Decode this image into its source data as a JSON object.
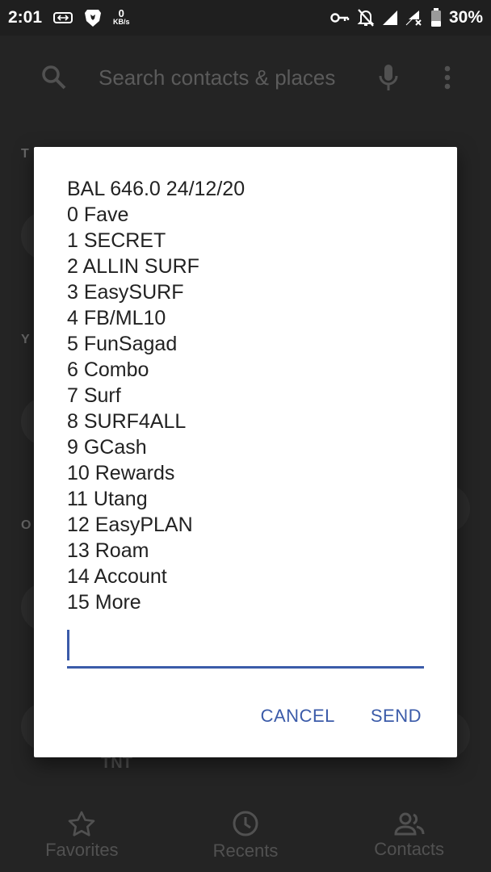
{
  "status_bar": {
    "time": "2:01",
    "netspeed_value": "0",
    "netspeed_unit": "KB/s",
    "battery": "30%",
    "icons": [
      "vpn-bars-icon",
      "brave-icon",
      "key-icon",
      "notifications-off-icon",
      "signal-icon",
      "signal-no-data-icon",
      "battery-icon"
    ]
  },
  "background_app": {
    "search_placeholder": "Search contacts & places",
    "section_letters": [
      "T",
      "Y",
      "O"
    ],
    "partial_contact": "TNT",
    "nav": [
      {
        "label": "Favorites",
        "icon": "star-icon"
      },
      {
        "label": "Recents",
        "icon": "clock-icon"
      },
      {
        "label": "Contacts",
        "icon": "people-icon"
      }
    ]
  },
  "dialog": {
    "lines": [
      "BAL 646.0 24/12/20",
      "0 Fave",
      "1 SECRET",
      "2 ALLIN SURF",
      "3 EasySURF",
      "4 FB/ML10",
      "5 FunSagad",
      "6 Combo",
      "7 Surf",
      "8 SURF4ALL",
      "9 GCash",
      "10 Rewards",
      "11 Utang",
      "12 EasyPLAN",
      "13 Roam",
      "14 Account",
      "15 More"
    ],
    "input_value": "",
    "cancel_label": "CANCEL",
    "send_label": "SEND"
  },
  "colors": {
    "accent": "#3b5ba9",
    "dialog_bg": "#ffffff",
    "scrim": "#2a2a2a"
  }
}
